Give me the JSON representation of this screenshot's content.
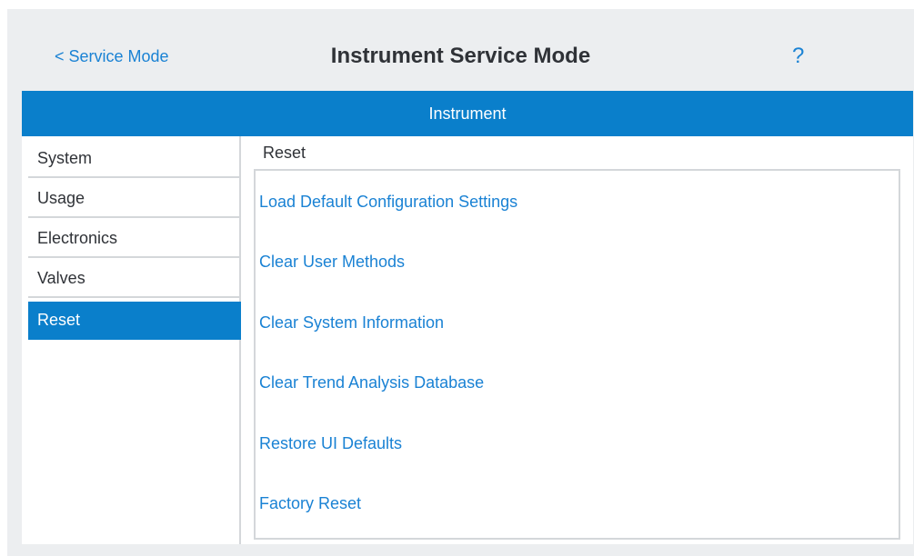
{
  "header": {
    "back_label": "< Service Mode",
    "title": "Instrument Service Mode",
    "help_label": "?"
  },
  "bar": {
    "title": "Instrument"
  },
  "sidebar": {
    "items": [
      {
        "label": "System",
        "active": false
      },
      {
        "label": "Usage",
        "active": false
      },
      {
        "label": "Electronics",
        "active": false
      },
      {
        "label": "Valves",
        "active": false
      },
      {
        "label": "Reset",
        "active": true
      }
    ]
  },
  "main": {
    "section_title": "Reset",
    "actions": [
      {
        "label": "Load Default Configuration Settings"
      },
      {
        "label": "Clear User Methods"
      },
      {
        "label": "Clear System Information"
      },
      {
        "label": "Clear Trend Analysis Database"
      },
      {
        "label": "Restore UI Defaults"
      },
      {
        "label": "Factory Reset"
      }
    ]
  },
  "colors": {
    "accent": "#0a7fcb",
    "link": "#1a82d4",
    "background": "#eceef0"
  }
}
